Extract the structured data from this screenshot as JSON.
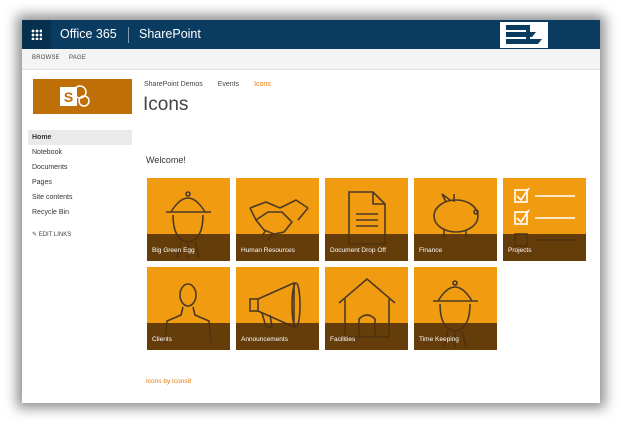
{
  "suitebar": {
    "app_name": "Office 365",
    "product": "SharePoint"
  },
  "ribbon": {
    "tabs": [
      "BROWSE",
      "PAGE"
    ]
  },
  "leftnav": {
    "items": [
      "Home",
      "Notebook",
      "Documents",
      "Pages",
      "Site contents",
      "Recycle Bin"
    ],
    "edit_links": "EDIT LINKS"
  },
  "breadcrumb": [
    "SharePoint Demos",
    "Events",
    "Icons"
  ],
  "page": {
    "title": "Icons",
    "welcome": "Welcome!",
    "credit": "Icons by Icons8"
  },
  "tiles": [
    {
      "label": "Big Green Egg",
      "icon": "grill-icon"
    },
    {
      "label": "Human Resources",
      "icon": "handshake-icon"
    },
    {
      "label": "Document Drop Off",
      "icon": "document-icon"
    },
    {
      "label": "Finance",
      "icon": "piggy-bank-icon"
    },
    {
      "label": "Projects",
      "icon": "checklist-icon"
    },
    {
      "label": "Clients",
      "icon": "person-icon"
    },
    {
      "label": "Announcements",
      "icon": "megaphone-icon"
    },
    {
      "label": "Facilities",
      "icon": "house-icon"
    },
    {
      "label": "Time Keeping",
      "icon": "grill-icon"
    }
  ],
  "colors": {
    "suitebar": "#0a3b60",
    "tile": "#f09b10",
    "accent": "#e47c0c",
    "site_logo": "#bf6f08"
  }
}
